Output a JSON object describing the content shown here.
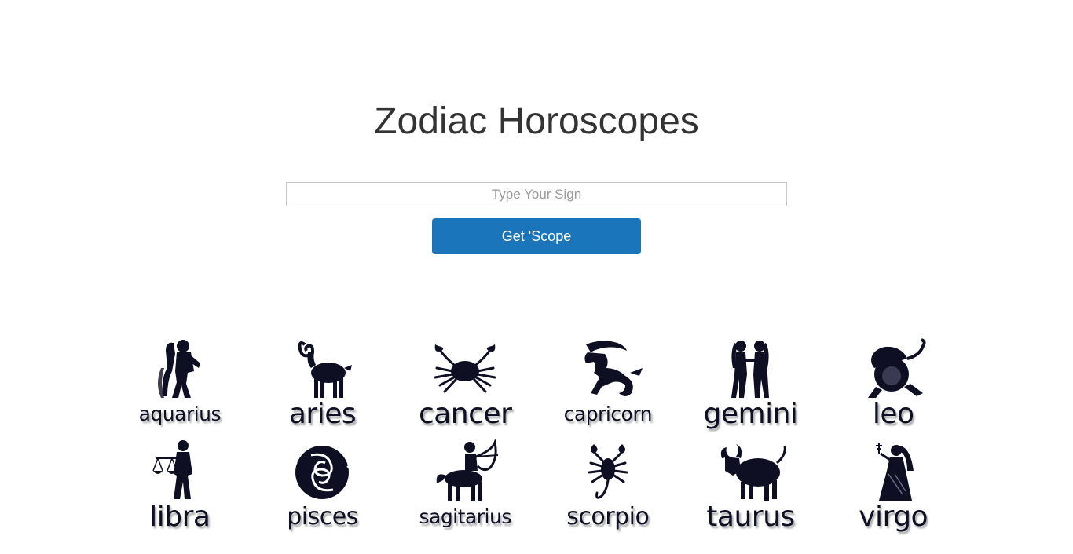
{
  "page": {
    "title": "Zodiac Horoscopes"
  },
  "search": {
    "placeholder": "Type Your Sign",
    "value": ""
  },
  "button": {
    "label": "Get 'Scope",
    "color": "#1a75bb"
  },
  "signs": [
    {
      "label": "aquarius",
      "icon": "aquarius-icon"
    },
    {
      "label": "aries",
      "icon": "aries-icon"
    },
    {
      "label": "cancer",
      "icon": "cancer-icon"
    },
    {
      "label": "capricorn",
      "icon": "capricorn-icon"
    },
    {
      "label": "gemini",
      "icon": "gemini-icon"
    },
    {
      "label": "leo",
      "icon": "leo-icon"
    },
    {
      "label": "libra",
      "icon": "libra-icon"
    },
    {
      "label": "pisces",
      "icon": "pisces-icon"
    },
    {
      "label": "sagitarius",
      "icon": "sagittarius-icon"
    },
    {
      "label": "scorpio",
      "icon": "scorpio-icon"
    },
    {
      "label": "taurus",
      "icon": "taurus-icon"
    },
    {
      "label": "virgo",
      "icon": "virgo-icon"
    }
  ],
  "colors": {
    "icon_fill": "#0f0f24",
    "title_text": "#333333"
  }
}
